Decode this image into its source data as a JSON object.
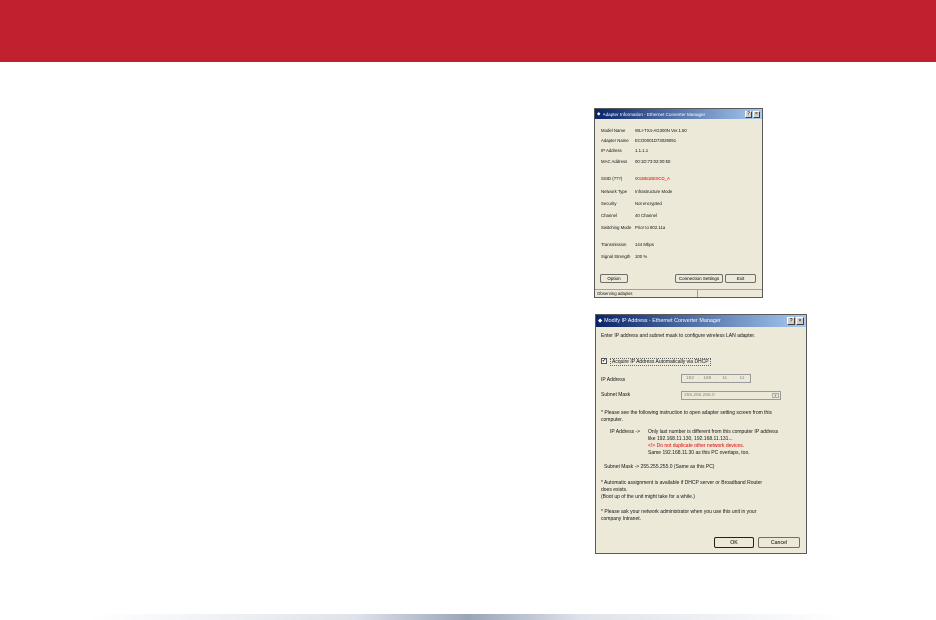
{
  "win1": {
    "title": "Adapter Information - Ethernet Converter Manager",
    "help": "?",
    "close": "×",
    "rows": [
      {
        "label": "Model Name",
        "value": "WLI-TX4-AG300N Ver.1.50"
      },
      {
        "label": "Adapter Name",
        "value": "ECO0001D73029091"
      },
      {
        "label": "IP Address",
        "value": "1.1.1.1"
      },
      {
        "label": "MAC Address",
        "value": "00:1D:73:02:00:50"
      },
      {
        "label": "SSID (???)",
        "value": "001BB1BE0CD_A"
      },
      {
        "label": "Network Type",
        "value": "Infrastructure Mode"
      },
      {
        "label": "Security",
        "value": "Not encrypted"
      },
      {
        "label": "Channel",
        "value": "40 Channel"
      },
      {
        "label": "Switching Mode",
        "value": "Prior to 802.11a"
      },
      {
        "label": "Transmission",
        "value": "144 Mbps"
      },
      {
        "label": "Signal Strength",
        "value": "100 %"
      }
    ],
    "buttons": {
      "option": "Option",
      "connection": "Connection Settings",
      "exit": "Exit"
    },
    "status": "Observing adapter."
  },
  "win2": {
    "title": "Modify IP Address - Ethernet Converter Manager",
    "help": "?",
    "close": "×",
    "intro": "Enter IP address and subnet mask to configure wireless LAN adapter.",
    "dhcp_label": "Acquire IP Address Automatically via DHCP",
    "dhcp_mark": "✔",
    "ip_label": "IP Address",
    "ip_value": [
      "192",
      "168",
      "11",
      "11"
    ],
    "ip_sep": ".",
    "mask_label": "Subnet Mask",
    "mask_value": "255.255.255.0",
    "dropdown_icon": "▼",
    "note1": "* Please see the following instruction to open adapter setting screen from this",
    "note1b": "computer.",
    "ip_note_head": "IP Address ->",
    "ip_note1": "Only last number is different from this computer IP address",
    "ip_note2": "like 192.168.11.130, 192.168.11.131...",
    "ip_note3": "<!> Do not duplicate other network devices.",
    "ip_note4": "Same 192.168.11.30 as this PC overlaps, too.",
    "mask_note": "Subnet Mask -> 255.255.255.0 (Same as this PC)",
    "auto_note1": "* Automatic assignment is available if DHCP server or Broadband Router",
    "auto_note2": "does exists.",
    "auto_note3": "(Boot up of the unit might take for a while.)",
    "admin_note1": "* Please ask your network administrator when you use this unit in your",
    "admin_note2": "company Intranet.",
    "ok": "OK",
    "cancel": "Cancel"
  }
}
